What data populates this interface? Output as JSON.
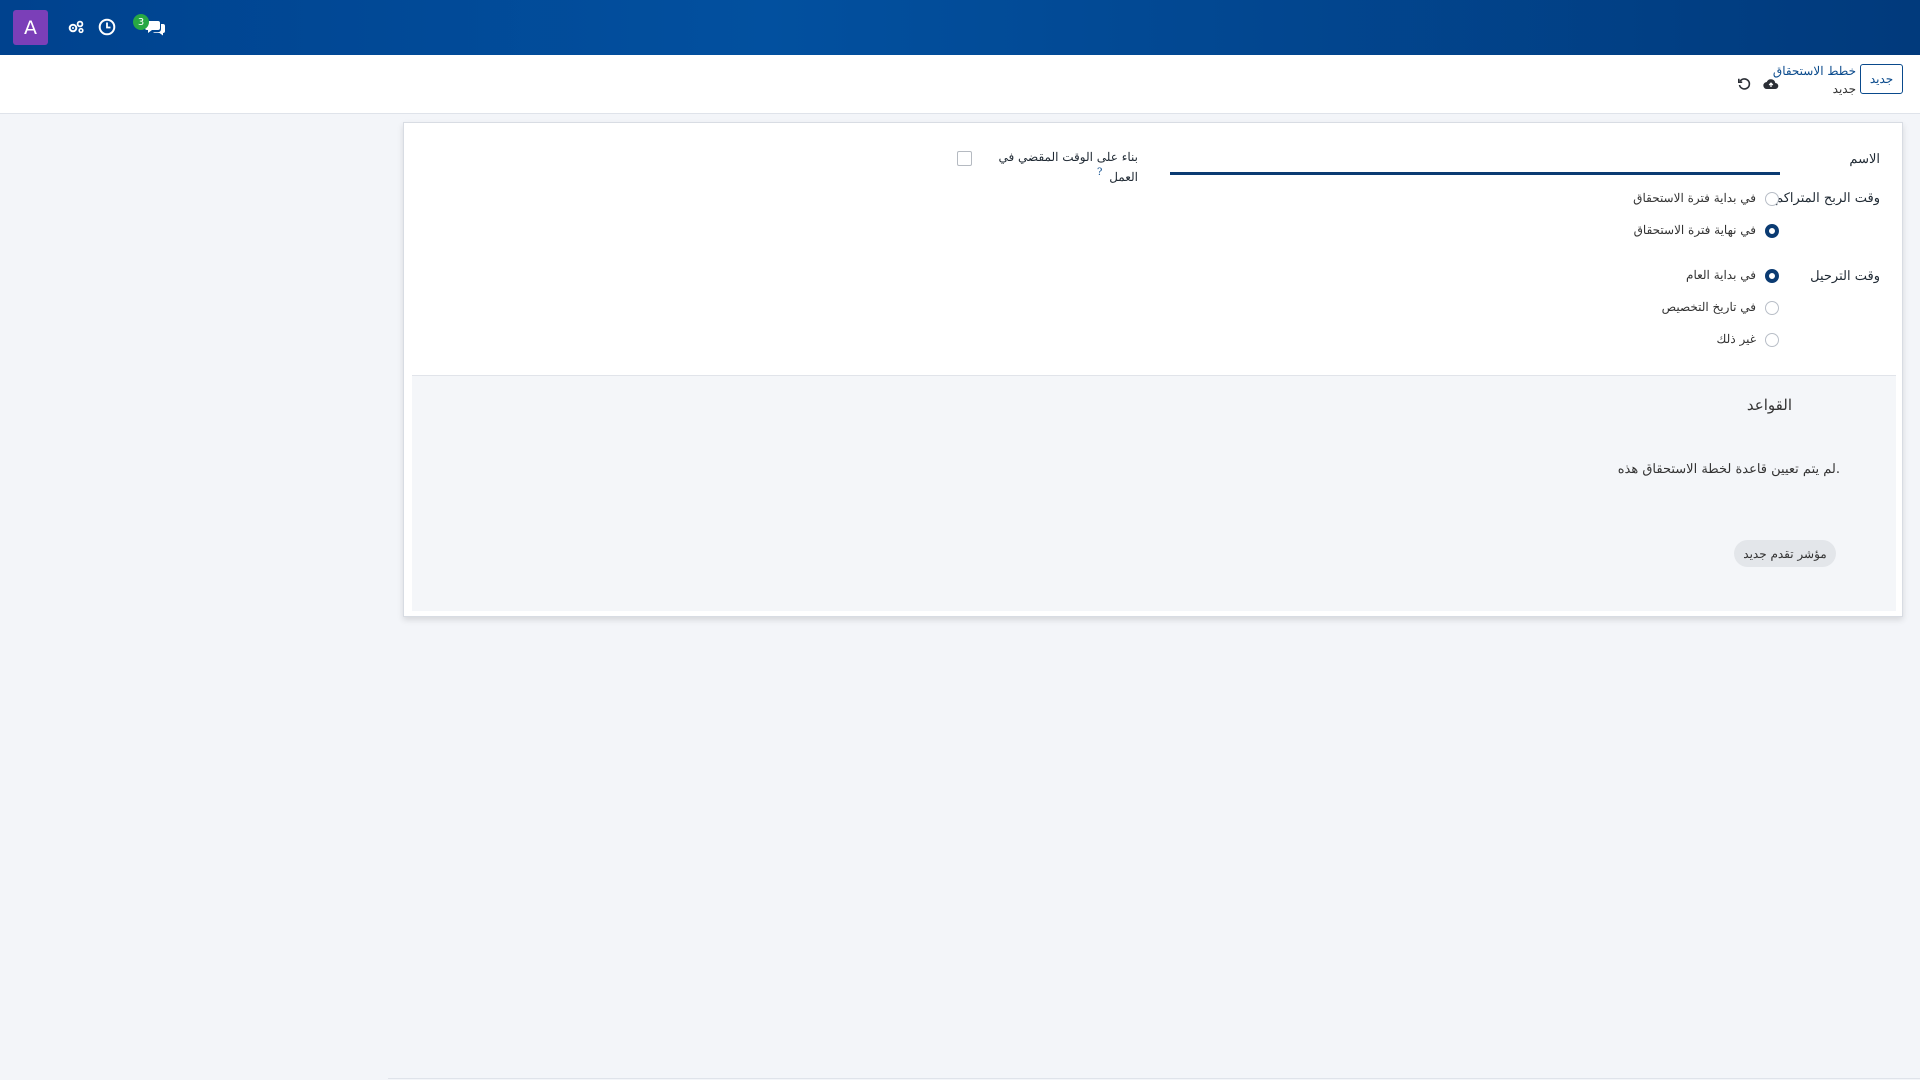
{
  "navbar": {
    "avatar_letter": "A",
    "message_count": "3",
    "icons": [
      "users-settings-icon",
      "clock-icon",
      "chat-icon"
    ]
  },
  "control_panel": {
    "new_button": "جديد",
    "breadcrumb_parent": "خطط الاستحقاق",
    "breadcrumb_current": "جديد",
    "icons": [
      "save-cloud-icon",
      "discard-icon"
    ]
  },
  "form": {
    "name_label": "الاسم",
    "worked_time_label_line1": "بناء على الوقت المقضي في",
    "worked_time_label_line2": "العمل",
    "help_mark": "?",
    "accrual_gain_label": "وقت الربح المتراكم",
    "accrual_gain_options": [
      {
        "label": "في بداية فترة الاستحقاق",
        "checked": false
      },
      {
        "label": "في نهاية فترة الاستحقاق",
        "checked": true
      }
    ],
    "carryover_label": "وقت الترحيل",
    "carryover_options": [
      {
        "label": "في بداية العام",
        "checked": true
      },
      {
        "label": "في تاريخ التخصيص",
        "checked": false
      },
      {
        "label": "غير ذلك",
        "checked": false
      }
    ]
  },
  "rules": {
    "title": "القواعد",
    "empty_text": "لم يتم تعيين قاعدة لخطة الاستحقاق هذه.",
    "new_milestone_button": "مؤشر تقدم جديد"
  },
  "colors": {
    "navbar": "#01468f",
    "accent": "#0b3b72",
    "avatar": "#7b3fb8",
    "badge": "#27a844"
  }
}
